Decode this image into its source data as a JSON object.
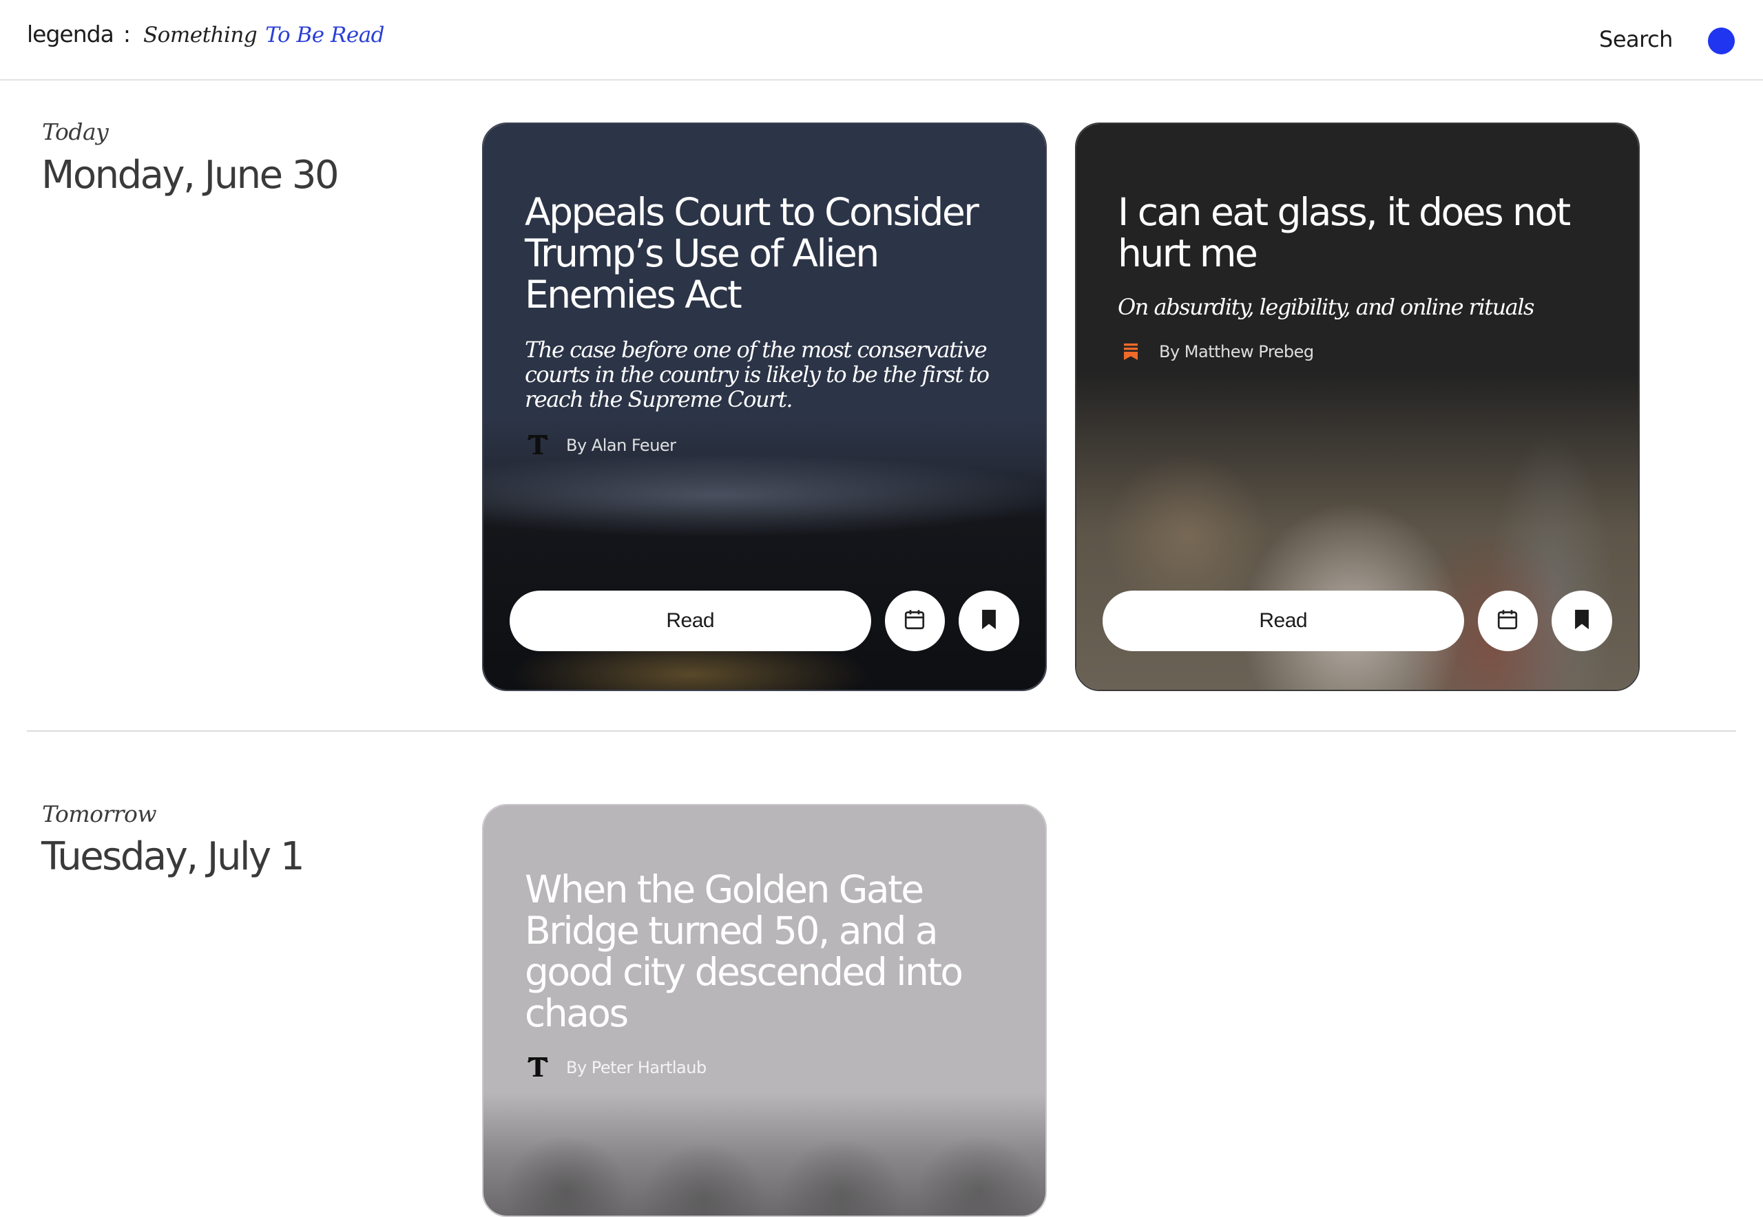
{
  "header": {
    "brand": "legenda",
    "separator": ":",
    "tagline_part1": "Something",
    "tagline_part2": "To Be Read",
    "search_label": "Search"
  },
  "days": [
    {
      "eyebrow": "Today",
      "date": "Monday, June 30",
      "cards": [
        {
          "title": "Appeals Court to Consider Trump’s Use of Alien Enemies Act",
          "dek": "The case before one of the most conservative courts in the country is likely to be the first to reach the Supreme Court.",
          "byline": "By Alan Feuer",
          "publisher_icon": "nyt-logo-icon",
          "read_label": "Read",
          "bg_color": "#2c3447"
        },
        {
          "title": "I can eat glass, it does not hurt me",
          "dek": "On absurdity, legibility, and online rituals",
          "byline": "By Matthew Prebeg",
          "publisher_icon": "substack-icon",
          "read_label": "Read",
          "bg_color": "#232323"
        }
      ]
    },
    {
      "eyebrow": "Tomorrow",
      "date": "Tuesday, July 1",
      "cards": [
        {
          "title": "When the Golden Gate Bridge turned 50, and a good city descended into chaos",
          "byline": "By Peter Hartlaub",
          "publisher_icon": "nyt-logo-icon",
          "bg_color": "#b8b6b8"
        }
      ]
    }
  ],
  "colors": {
    "accent_blue": "#1f35f0",
    "tagline_blue": "#2a3fd6",
    "substack_orange": "#f06a2a"
  }
}
